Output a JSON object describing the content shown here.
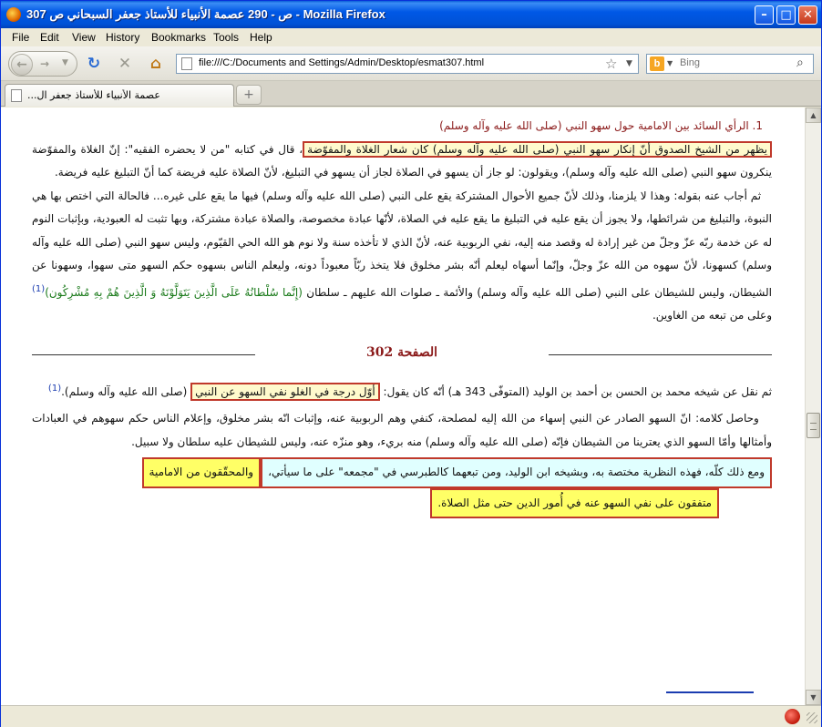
{
  "window": {
    "title": "307 ص - 290 عصمة الأنبياء للأستاذ جعفر السبحاني ص - Mozilla Firefox",
    "minimize_label": "–",
    "maximize_label": "□",
    "close_label": "✕"
  },
  "menu": [
    "File",
    "Edit",
    "View",
    "History",
    "Bookmarks",
    "Tools",
    "Help"
  ],
  "nav": {
    "url": "file:///C:/Documents and Settings/Admin/Desktop/esmat307.html",
    "search_placeholder": "Bing",
    "search_engine_letter": "b"
  },
  "tabs": [
    {
      "label": "...عصمة الأنبياء للأستاذ جعفر ال"
    }
  ],
  "doc": {
    "heading": "1. الرأي السائد بين الامامية حول سهو النبي (صلى الله عليه وآله وسلم)",
    "p1_highlight": "يظهر من الشيخ الصدوق أنّ إنكار سهو النبي (صلى الله عليه وآله وسلم) كان شعار الغلاة والمفوّضة",
    "p1_rest": "، قال في كتابه \"من لا يحضره الفقيه\": إنّ الغلاة والمفوّضة ينكرون سهو النبي (صلى الله عليه وآله وسلم)، ويقولون: لو جاز أن يسهو في الصلاة لجاز أن يسهو في التبليغ، لأنّ الصلاة عليه فريضة كما أنّ التبليغ عليه فريضة.",
    "p2_main": "ثم أجاب عنه بقوله: وهذا لا يلزمنا، وذلك لأنّ جميع الأحوال المشتركة يقع على النبي (صلى الله عليه وآله وسلم) فيها ما يقع على غيره... فالحالة التي اختص بها هي النبوة، والتبليغ من شرائطها، ولا يجوز أن يقع عليه في التبليغ ما يقع عليه في الصلاة، لأنّها عبادة مخصوصة، والصلاة عبادة مشتركة، وبها تثبت له العبودية، وبإثبات النوم له عن خدمة ربّه عزّ وجلّ من غير إرادة له وقصد منه إليه، نفي الربوبية عنه، لأنّ الذي لا تأخذه سنة ولا نوم هو الله الحي القيّوم، وليس سهو النبي (صلى الله عليه وآله وسلم) كسهونا، لأنّ سهوه من الله عزّ وجلّ، وإنّما أسهاه ليعلم أنّه بشر مخلوق فلا يتخذ ربّاً معبوداً دونه، وليعلم الناس بسهوه حكم السهو متى سهوا، وسهونا عن الشيطان، وليس للشيطان على النبي (صلى الله عليه وآله وسلم) والأئمة ـ صلوات الله عليهم ـ سلطان ",
    "p2_quran": "(إِنَّما سُلْطانُهُ عَلَى الَّذِينَ يَتَوَلَّوْنَهُ وَ الَّذِينَ هُمْ بِهِ مُشْرِكُون)",
    "p2_fn": "(1)",
    "p2_end": " وعلى من تبعه من الغاوين.",
    "page_label": "الصفحة 302",
    "p3_pre": "ثم نقل عن شيخه محمد بن الحسن بن أحمد بن الوليد (المتوفّى 343 هـ) أنّه كان يقول: ",
    "p3_highlight": "أوّل درجة في الغلو نفي السهو عن النبي",
    "p3_post": " (صلى الله عليه وآله وسلم).",
    "p3_fn": "(1)",
    "p4": "وحاصل كلامه: انّ السهو الصادر عن النبي إسهاء من الله إليه لمصلحة، كنفي وهم الربوبية عنه، وإثبات انّه بشر مخلوق، وإعلام الناس حكم سهوهم في العبادات وأمثالها وأمّا السهو الذي يعترينا من الشيطان فإنّه (صلى الله عليه وآله وسلم) منه بريء، وهو منزّه عنه، وليس للشيطان عليه سلطان ولا سبيل.",
    "p5_cyan": "ومع ذلك كلّه، فهذه النظرية مختصة به، وبشيخه ابن الوليد، ومن تبعهما كالطبرسي في \"مجمعه\" على ما سيأتي،",
    "p5_yellow1": " والمحقّقون من الامامية",
    "p5_yellow2": "متفقون على نفي السهو عنه في أُمور الدين حتى مثل الصلاة."
  },
  "colors": {
    "heading": "#8b1a1a",
    "highlight_border": "#c0392b",
    "yellow": "#ffff66",
    "cyan": "#e0ffff",
    "quran": "#1a7a1a",
    "footnote": "#1a3cb0",
    "titlebar": "#0058e6"
  },
  "icons": {
    "app": "firefox-icon",
    "back": "back-arrow-icon",
    "forward": "forward-arrow-icon",
    "reload": "reload-icon",
    "stop": "stop-icon",
    "home": "home-icon",
    "bookmark": "star-icon",
    "search": "magnifier-icon",
    "new_tab": "plus-icon",
    "status": "addon-status-icon"
  }
}
